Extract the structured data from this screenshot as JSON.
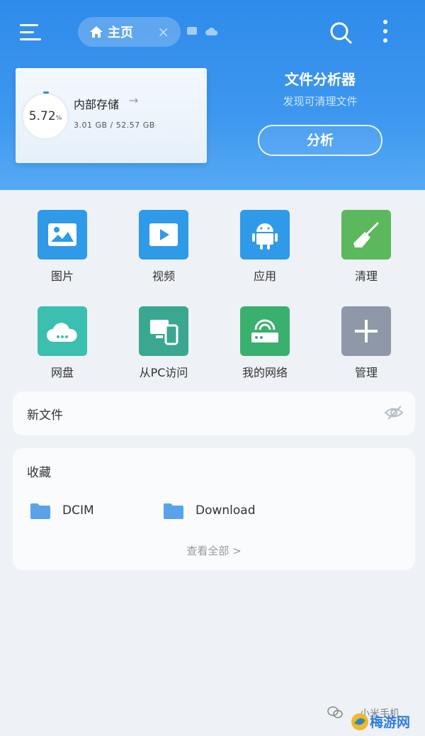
{
  "topbar": {
    "home_tab_label": "主页"
  },
  "storage": {
    "percent": "5.72",
    "percent_sign": "%",
    "title": "内部存储",
    "arrow": "→",
    "size": "3.01 GB / 52.57 GB"
  },
  "analyzer": {
    "title": "文件分析器",
    "subtitle": "发现可清理文件",
    "button_label": "分析"
  },
  "grid": [
    {
      "label": "图片",
      "icon": "image-icon",
      "color": "#2f9ae8"
    },
    {
      "label": "视频",
      "icon": "video-icon",
      "color": "#2f9ae8"
    },
    {
      "label": "应用",
      "icon": "android-icon",
      "color": "#2f9ae8"
    },
    {
      "label": "清理",
      "icon": "broom-icon",
      "color": "#5cb85c"
    },
    {
      "label": "网盘",
      "icon": "cloud-icon",
      "color": "#3bbfb0"
    },
    {
      "label": "从PC访问",
      "icon": "pc-access-icon",
      "color": "#3aa890"
    },
    {
      "label": "我的网络",
      "icon": "router-icon",
      "color": "#3ab06e"
    },
    {
      "label": "管理",
      "icon": "plus-icon",
      "color": "#8e98a8"
    }
  ],
  "new_files": {
    "title": "新文件"
  },
  "favorites": {
    "title": "收藏",
    "items": [
      {
        "label": "DCIM"
      },
      {
        "label": "Download"
      }
    ],
    "view_all": "查看全部 >"
  },
  "watermark": {
    "text": "小米手机",
    "site": "梅游网"
  }
}
